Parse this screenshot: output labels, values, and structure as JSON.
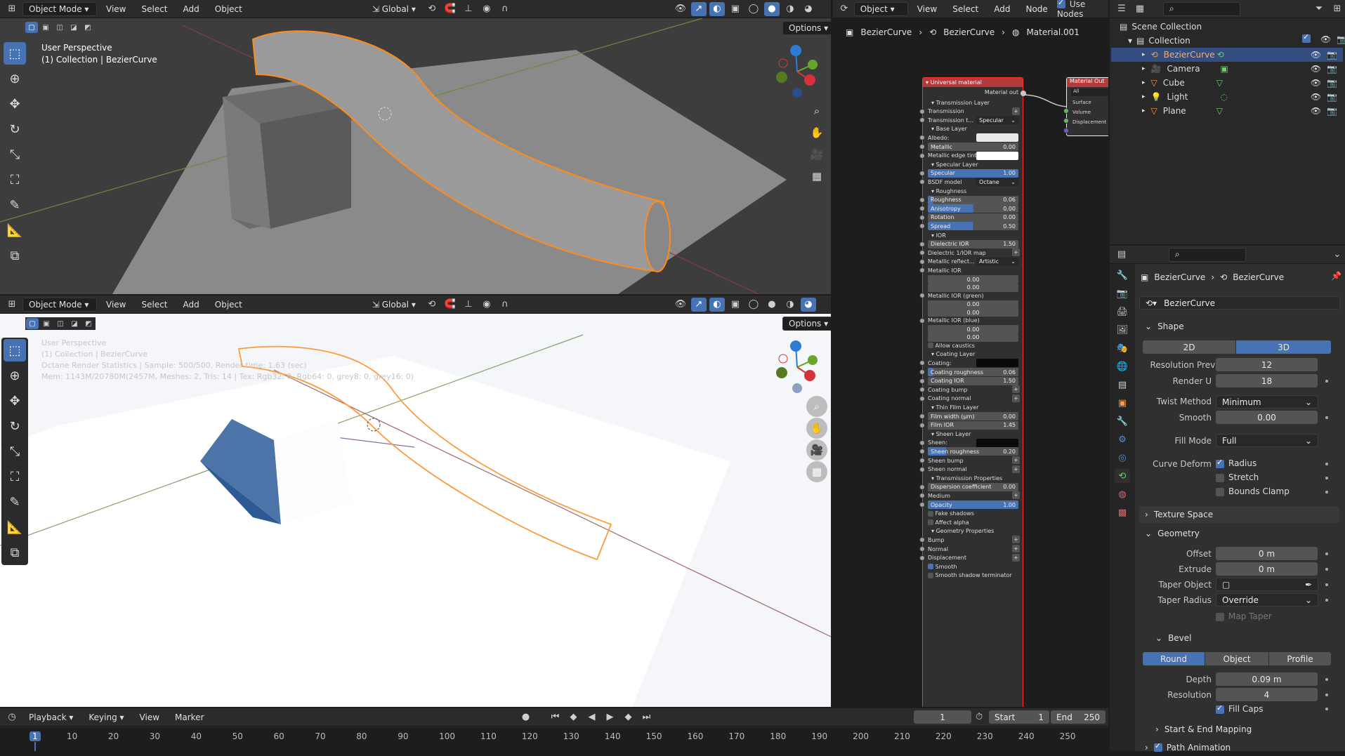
{
  "colors": {
    "accent": "#4772b3",
    "selection": "#ff8c1a",
    "header": "#2b2b2b",
    "panel": "#303030"
  },
  "viewport_top": {
    "mode": "Object Mode",
    "menus": [
      "View",
      "Select",
      "Add",
      "Object"
    ],
    "transform": "Global",
    "options": "Options",
    "overlay_title": "User Perspective",
    "overlay_sub": "(1) Collection | BezierCurve"
  },
  "viewport_bottom": {
    "mode": "Object Mode",
    "menus": [
      "View",
      "Select",
      "Add",
      "Object"
    ],
    "transform": "Global",
    "options": "Options",
    "overlay_title": "User Perspective",
    "overlay_sub": "(1) Collection | BezierCurve",
    "overlay_stats": "Octane Render Statistics | Sample: 500/500, Render time: 1.63 (sec)",
    "overlay_mem": "Mem: 1143M/20780M(2457M, Meshes: 2, Tris: 14 | Tex: Rgb32: 0, Rgb64: 0, grey8: 0, grey16: 0)"
  },
  "node_editor": {
    "mode": "Object",
    "menus": [
      "View",
      "Select",
      "Add",
      "Node"
    ],
    "use_nodes": "Use Nodes",
    "breadcrumb": [
      "BezierCurve",
      "BezierCurve",
      "Material.001"
    ],
    "node_title": "Universal material",
    "output_socket": "Material out",
    "out_node_title": "Material Out",
    "out_node_rows": [
      "All",
      "Surface",
      "Volume",
      "Displacement"
    ],
    "rows": [
      {
        "t": "head",
        "label": "Transmission Layer"
      },
      {
        "t": "plus",
        "label": "Transmission"
      },
      {
        "t": "drop",
        "label": "Transmission t...",
        "value": "Specular"
      },
      {
        "t": "head",
        "label": "Base Layer"
      },
      {
        "t": "color",
        "label": "Albedo:",
        "color": "#e8e8e8"
      },
      {
        "t": "field",
        "label": "Metallic",
        "value": "0.00",
        "fill": 0
      },
      {
        "t": "color",
        "label": "Metallic edge tint:",
        "color": "#ffffff"
      },
      {
        "t": "head",
        "label": "Specular Layer"
      },
      {
        "t": "field",
        "label": "Specular",
        "value": "1.00",
        "fill": 1
      },
      {
        "t": "drop",
        "label": "BSDF model",
        "value": "Octane"
      },
      {
        "t": "head",
        "label": "Roughness"
      },
      {
        "t": "field",
        "label": "Roughness",
        "value": "0.06",
        "fill": 0.06
      },
      {
        "t": "field",
        "label": "Anisotropy",
        "value": "0.00",
        "fill": 0.5
      },
      {
        "t": "field",
        "label": "Rotation",
        "value": "0.00",
        "fill": 0
      },
      {
        "t": "field",
        "label": "Spread",
        "value": "0.50",
        "fill": 0.5
      },
      {
        "t": "head",
        "label": "IOR"
      },
      {
        "t": "field",
        "label": "Dielectric IOR",
        "value": "1.50",
        "fill": 0
      },
      {
        "t": "plus",
        "label": "Dielectric 1/IOR map"
      },
      {
        "t": "drop",
        "label": "Metallic reflect...",
        "value": "Artistic"
      },
      {
        "t": "label",
        "label": "Metallic IOR"
      },
      {
        "t": "val",
        "value": "0.00"
      },
      {
        "t": "val",
        "value": "0.00"
      },
      {
        "t": "label",
        "label": "Metallic IOR (green)"
      },
      {
        "t": "val",
        "value": "0.00"
      },
      {
        "t": "val",
        "value": "0.00"
      },
      {
        "t": "label",
        "label": "Metallic IOR (blue)"
      },
      {
        "t": "val",
        "value": "0.00"
      },
      {
        "t": "val",
        "value": "0.00"
      },
      {
        "t": "check",
        "label": "Allow caustics",
        "on": false
      },
      {
        "t": "head",
        "label": "Coating Layer"
      },
      {
        "t": "color",
        "label": "Coating:",
        "color": "#0a0a0a"
      },
      {
        "t": "field",
        "label": "Coating roughness",
        "value": "0.06",
        "fill": 0.06
      },
      {
        "t": "field",
        "label": "Coating IOR",
        "value": "1.50",
        "fill": 0
      },
      {
        "t": "plus",
        "label": "Coating bump"
      },
      {
        "t": "plus",
        "label": "Coating normal"
      },
      {
        "t": "head",
        "label": "Thin Film Layer"
      },
      {
        "t": "field",
        "label": "Film width (μm)",
        "value": "0.00",
        "fill": 0
      },
      {
        "t": "field",
        "label": "Film IOR",
        "value": "1.45",
        "fill": 0
      },
      {
        "t": "head",
        "label": "Sheen Layer"
      },
      {
        "t": "color",
        "label": "Sheen:",
        "color": "#0a0a0a"
      },
      {
        "t": "field",
        "label": "Sheen roughness",
        "value": "0.20",
        "fill": 0.2
      },
      {
        "t": "plus",
        "label": "Sheen bump"
      },
      {
        "t": "plus",
        "label": "Sheen normal"
      },
      {
        "t": "head",
        "label": "Transmission Properties"
      },
      {
        "t": "field",
        "label": "Dispersion coefficient",
        "value": "0.00",
        "fill": 0
      },
      {
        "t": "plus",
        "label": "Medium"
      },
      {
        "t": "field",
        "label": "Opacity",
        "value": "1.00",
        "fill": 1
      },
      {
        "t": "check",
        "label": "Fake shadows",
        "on": false
      },
      {
        "t": "check",
        "label": "Affect alpha",
        "on": false
      },
      {
        "t": "head",
        "label": "Geometry Properties"
      },
      {
        "t": "plus",
        "label": "Bump"
      },
      {
        "t": "plus",
        "label": "Normal"
      },
      {
        "t": "plus",
        "label": "Displacement"
      },
      {
        "t": "check",
        "label": "Smooth",
        "on": true
      },
      {
        "t": "check",
        "label": "Smooth shadow terminator",
        "on": false
      }
    ]
  },
  "outliner": {
    "root": "Scene Collection",
    "collection": "Collection",
    "items": [
      {
        "name": "BezierCurve",
        "selected": true
      },
      {
        "name": "Camera",
        "selected": false
      },
      {
        "name": "Cube",
        "selected": false
      },
      {
        "name": "Light",
        "selected": false
      },
      {
        "name": "Plane",
        "selected": false
      }
    ]
  },
  "properties": {
    "breadcrumb": [
      "BezierCurve",
      "BezierCurve"
    ],
    "datablock": "BezierCurve",
    "shape": {
      "title": "Shape",
      "dim_2d": "2D",
      "dim_3d": "3D",
      "res_preview_label": "Resolution Previ...",
      "res_preview": "12",
      "render_u_label": "Render U",
      "render_u": "18",
      "twist_label": "Twist Method",
      "twist": "Minimum",
      "smooth_label": "Smooth",
      "smooth": "0.00",
      "fill_label": "Fill Mode",
      "fill": "Full",
      "deform_label": "Curve Deform",
      "radius": "Radius",
      "stretch": "Stretch",
      "bounds": "Bounds Clamp"
    },
    "texture_space": "Texture Space",
    "geometry": {
      "title": "Geometry",
      "offset_label": "Offset",
      "offset": "0 m",
      "extrude_label": "Extrude",
      "extrude": "0 m",
      "taper_obj_label": "Taper Object",
      "taper_radius_label": "Taper Radius",
      "taper_radius": "Override",
      "map_taper": "Map Taper"
    },
    "bevel": {
      "title": "Bevel",
      "round": "Round",
      "object": "Object",
      "profile": "Profile",
      "depth_label": "Depth",
      "depth": "0.09 m",
      "resolution_label": "Resolution",
      "resolution": "4",
      "fill_caps": "Fill Caps"
    },
    "start_end": "Start & End Mapping",
    "path_anim": "Path Animation"
  },
  "timeline": {
    "menus": [
      "Playback",
      "Keying",
      "View",
      "Marker"
    ],
    "current": "1",
    "start_label": "Start",
    "start": "1",
    "end_label": "End",
    "end": "250",
    "ticks": [
      "1",
      "10",
      "20",
      "30",
      "40",
      "50",
      "60",
      "70",
      "80",
      "90",
      "100",
      "110",
      "120",
      "130",
      "140",
      "150",
      "160",
      "170",
      "180",
      "190",
      "200",
      "210",
      "220",
      "230",
      "240",
      "250"
    ]
  }
}
